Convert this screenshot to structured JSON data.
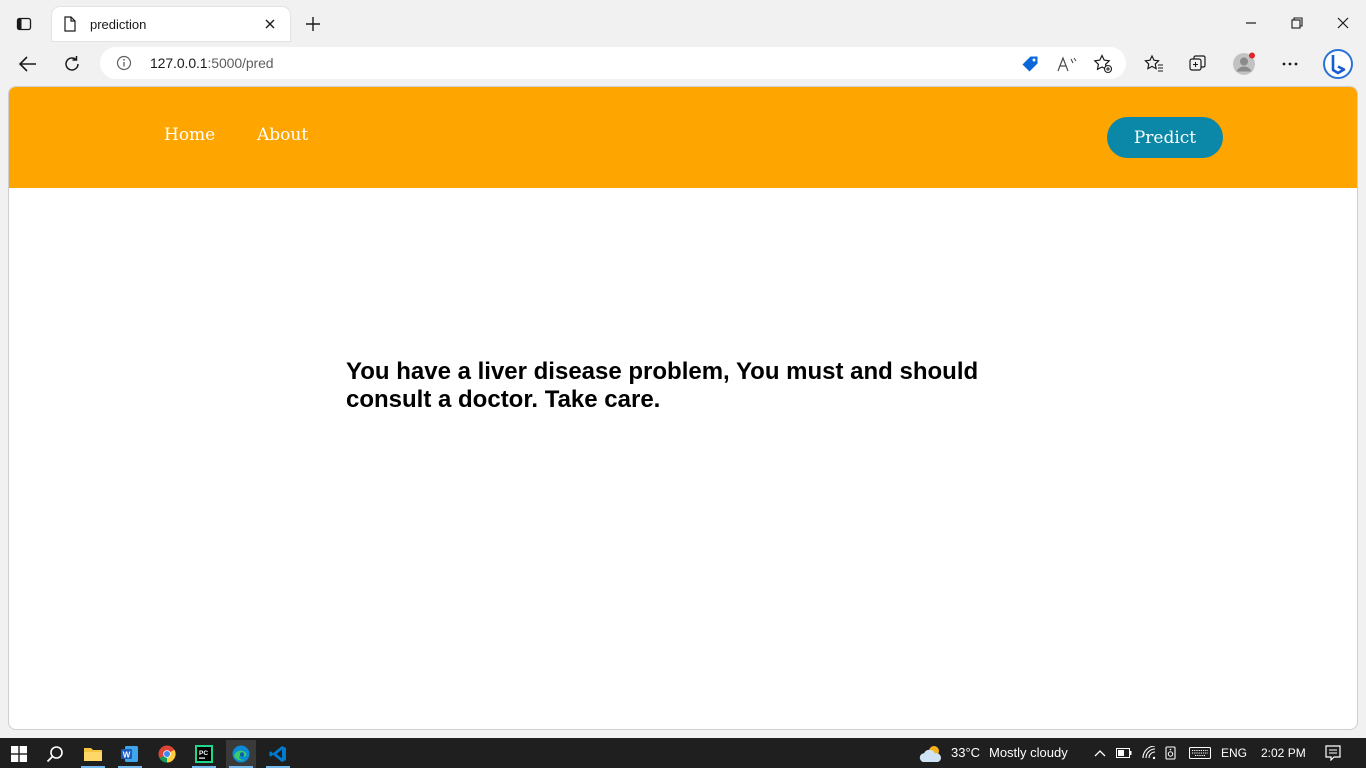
{
  "browser": {
    "tab": {
      "title": "prediction"
    },
    "address": {
      "host": "127.0.0.1",
      "path": ":5000/pred"
    }
  },
  "page": {
    "nav": {
      "home": "Home",
      "about": "About",
      "predict": "Predict"
    },
    "message": "You have a liver disease problem, You must and should consult a doctor. Take care."
  },
  "taskbar": {
    "weather": {
      "temp": "33°C",
      "condition": "Mostly cloudy"
    },
    "language": "ENG",
    "time": "2:02 PM"
  },
  "colors": {
    "navbar": "#ffa500",
    "predict_button": "#0b87a8",
    "taskbar": "#1f1f1f"
  }
}
